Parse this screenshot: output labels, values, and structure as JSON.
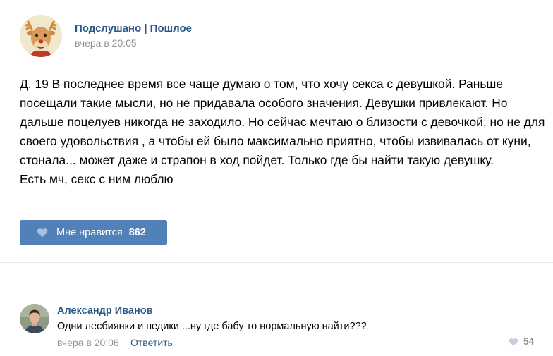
{
  "post": {
    "author": "Подслушано | Пошлое",
    "date": "вчера в 20:05",
    "text_lines": [
      "Д. 19 В последнее время все чаще думаю о том, что хочу секса с девушкой. Раньше посещали такие мысли, но не придавала особого значения. Девушки привлекают. Но дальше поцелуев никогда не заходило. Но сейчас мечтаю о близости с девочкой, но не для своего удовольствия , а чтобы ей было максимально приятно, чтобы извивалась от куни, стонала... может даже и страпон в ход пойдет. Только где бы найти такую девушку.",
      "Есть мч, секс с ним люблю"
    ],
    "like_label": "Мне нравится",
    "like_count": "862",
    "like_button_color": "#5181b8"
  },
  "comment": {
    "author": "Александр Иванов",
    "text": "Одни лесбиянки и педики ...ну где бабу то нормальную найти???",
    "date": "вчера в 20:06",
    "reply_label": "Ответить",
    "like_count": "54"
  },
  "icons": {
    "post_avatar": "reindeer-avatar-icon",
    "like": "heart-icon",
    "comment_avatar": "user-photo-avatar"
  },
  "colors": {
    "link": "#2a5885",
    "meta": "#939393",
    "divider": "#e7e8ec"
  }
}
